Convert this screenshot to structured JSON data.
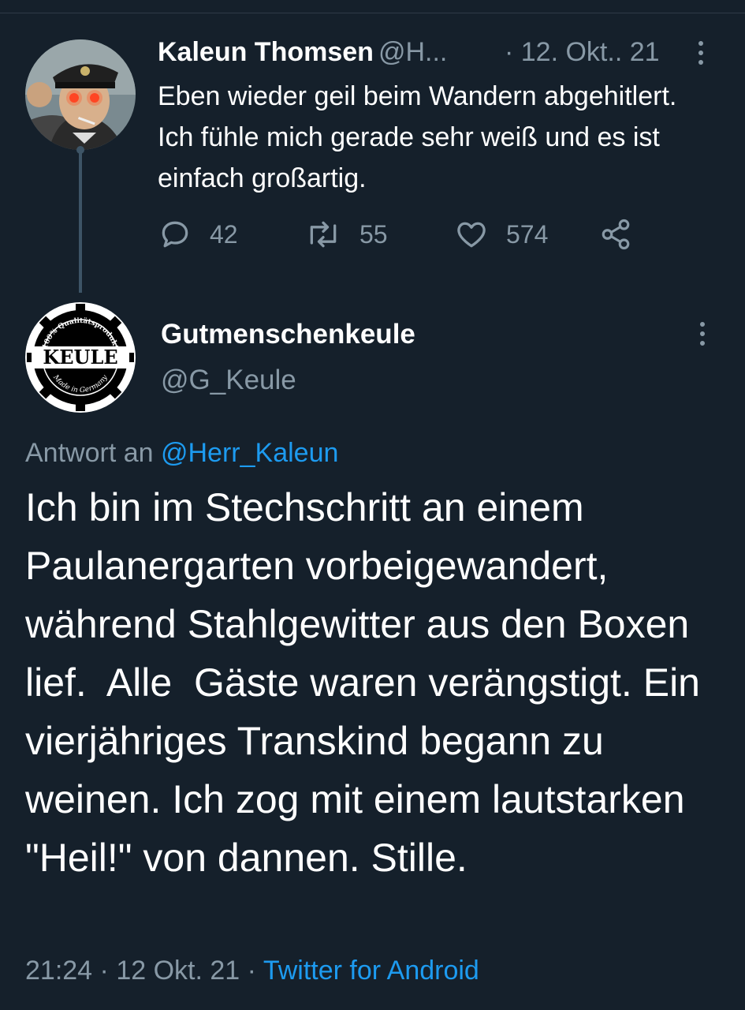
{
  "parent_tweet": {
    "display_name": "Kaleun Thomsen",
    "handle": "@H...",
    "date": "· 12. Okt.. 21",
    "text": "Eben wieder geil beim Wandern abgehitlert. Ich fühle mich gerade sehr weiß und es ist einfach großartig.",
    "replies": "42",
    "retweets": "55",
    "likes": "574"
  },
  "reply_tweet": {
    "display_name": "Gutmenschenkeule",
    "handle": "@G_Keule",
    "avatar": {
      "top_text": "100% Qualitätsprodukt",
      "center_text": "KEULE",
      "bottom_text": "Made in Germany"
    },
    "reply_to_prefix": "Antwort an",
    "reply_to_handle": "@Herr_Kaleun",
    "text": "Ich bin im Stechschritt an einem Paulanergarten vorbeigewandert, während Stahlgewitter aus den Boxen lief.  Alle  Gäste waren verängstigt. Ein vierjähriges Transkind begann zu weinen. Ich zog mit einem lautstarken \"Heil!\" von dannen. Stille.",
    "time": "21:24",
    "date": "12 Okt. 21",
    "separator": "·",
    "source": "Twitter for Android"
  },
  "colors": {
    "background": "#15202b",
    "secondary_text": "#8899a6",
    "link": "#1d9bf0",
    "thread_line": "#3d5466"
  }
}
